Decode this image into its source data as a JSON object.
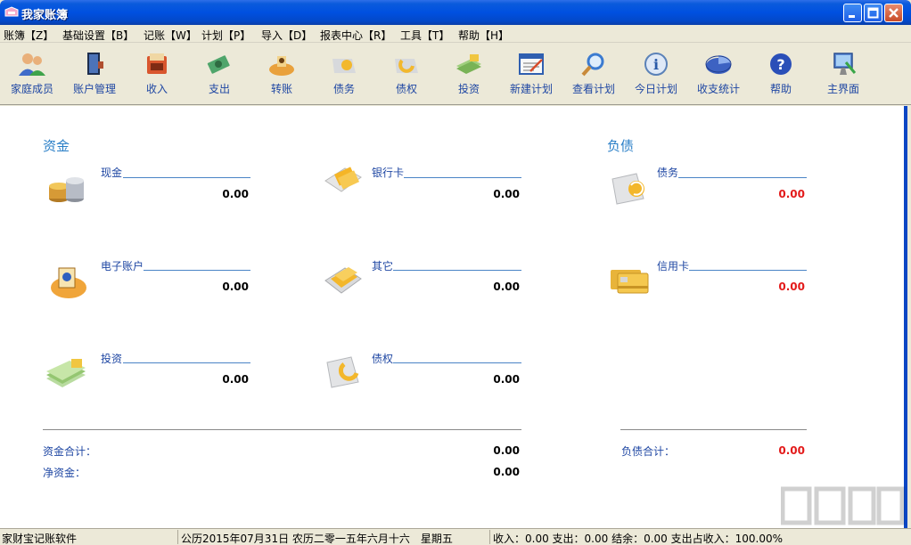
{
  "window": {
    "title": "我家账簿"
  },
  "menu": [
    {
      "label": "账簿【Z】"
    },
    {
      "label": "基础设置【B】"
    },
    {
      "label": "记账【W】"
    },
    {
      "label": "计划【P】"
    },
    {
      "label": "导入【D】"
    },
    {
      "label": "报表中心【R】"
    },
    {
      "label": "工具【T】"
    },
    {
      "label": "帮助【H】"
    }
  ],
  "toolbar": [
    {
      "label": "家庭成员",
      "icon": "family-members-icon"
    },
    {
      "label": "账户管理",
      "icon": "account-manage-icon"
    },
    {
      "label": "收入",
      "icon": "income-icon"
    },
    {
      "label": "支出",
      "icon": "expense-icon"
    },
    {
      "label": "转账",
      "icon": "transfer-icon"
    },
    {
      "label": "债务",
      "icon": "debt-icon"
    },
    {
      "label": "债权",
      "icon": "credit-icon"
    },
    {
      "label": "投资",
      "icon": "invest-icon"
    },
    {
      "label": "新建计划",
      "icon": "new-plan-icon"
    },
    {
      "label": "查看计划",
      "icon": "view-plan-icon"
    },
    {
      "label": "今日计划",
      "icon": "today-plan-icon"
    },
    {
      "label": "收支统计",
      "icon": "statistics-icon"
    },
    {
      "label": "帮助",
      "icon": "help-icon"
    },
    {
      "label": "主界面",
      "icon": "home-icon"
    }
  ],
  "funds": {
    "title": "资金",
    "items": [
      {
        "label": "现金",
        "value": "0.00",
        "icon": "coins-icon"
      },
      {
        "label": "银行卡",
        "value": "0.00",
        "icon": "bank-card-icon"
      },
      {
        "label": "电子账户",
        "value": "0.00",
        "icon": "e-account-icon"
      },
      {
        "label": "其它",
        "value": "0.00",
        "icon": "other-icon"
      },
      {
        "label": "投资",
        "value": "0.00",
        "icon": "money-stack-icon"
      },
      {
        "label": "债权",
        "value": "0.00",
        "icon": "receivable-icon"
      }
    ],
    "total_label": "资金合计：",
    "total_value": "0.00",
    "net_label": "净资金：",
    "net_value": "0.00"
  },
  "liabilities": {
    "title": "负债",
    "items": [
      {
        "label": "债务",
        "value": "0.00",
        "icon": "liability-icon"
      },
      {
        "label": "信用卡",
        "value": "0.00",
        "icon": "credit-card-icon"
      }
    ],
    "total_label": "负债合计：",
    "total_value": "0.00"
  },
  "status": {
    "app_name": "家财宝记账软件",
    "date": "公历2015年07月31日 农历二零一五年六月十六　星期五",
    "summary": "收入：0.00 支出：0.00 结余：0.00 支出占收入：100.00%"
  },
  "colors": {
    "accent": "#1f47a3",
    "negative": "#e31b1b",
    "titlebar": "#0050e0"
  }
}
